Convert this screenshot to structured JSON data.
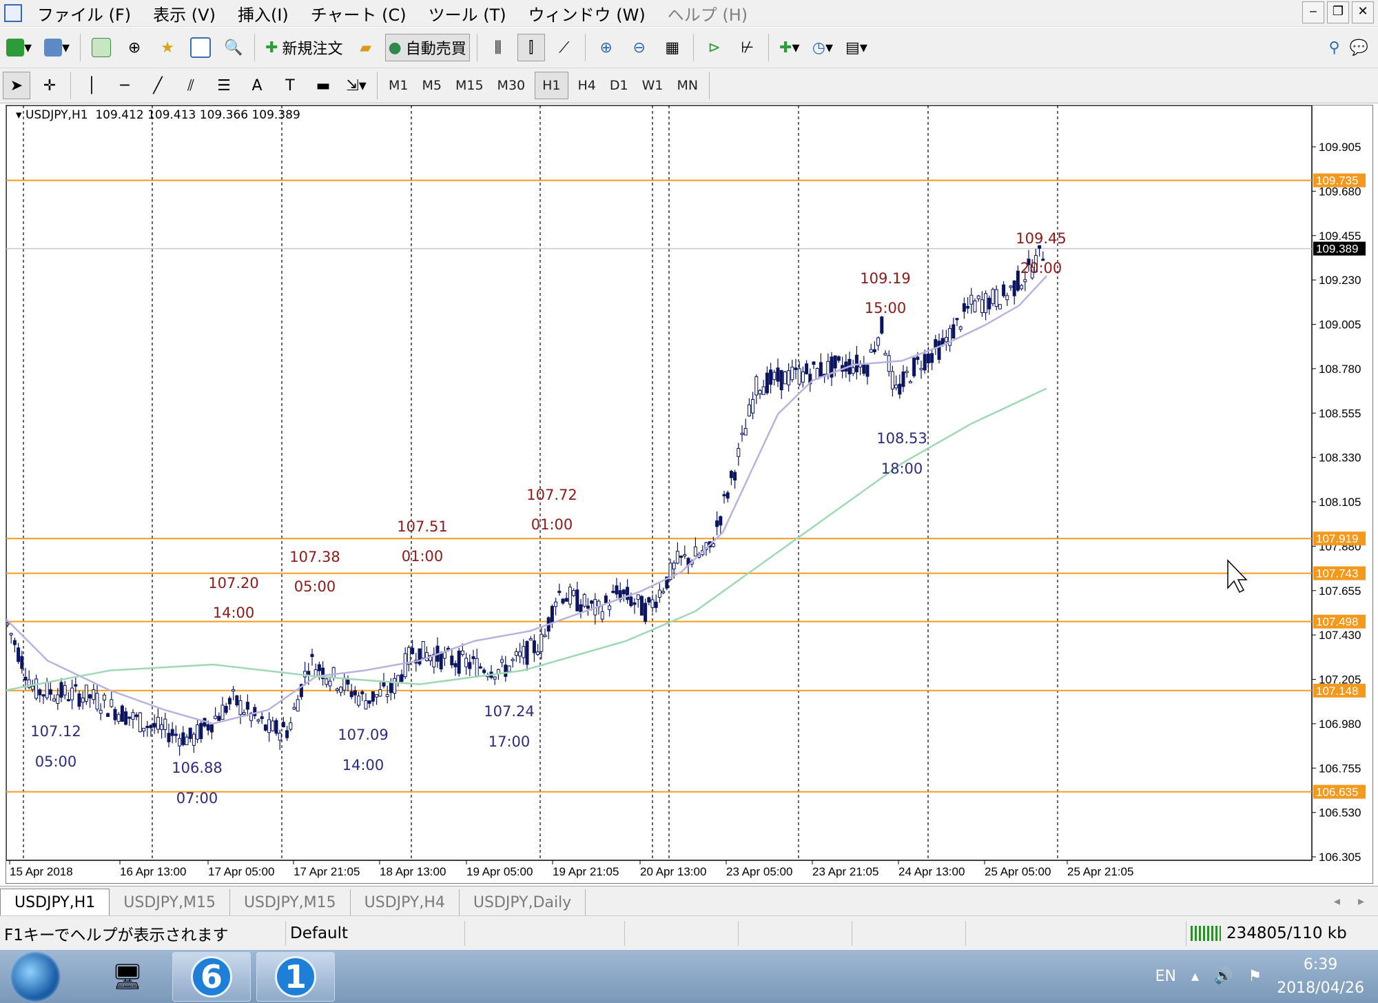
{
  "menu": {
    "items": [
      "ファイル (F)",
      "表示 (V)",
      "挿入(I)",
      "チャート (C)",
      "ツール (T)",
      "ウィンドウ (W)",
      "ヘルプ (H)"
    ]
  },
  "toolbar": {
    "new_order": "新規注文",
    "auto_trading": "自動売買",
    "timeframes": [
      "M1",
      "M5",
      "M15",
      "M30",
      "H1",
      "H4",
      "D1",
      "W1",
      "MN"
    ],
    "active_timeframe": "H1"
  },
  "chart": {
    "header": "USDJPY,H1  109.412 109.413 109.366 109.389",
    "current_price": "109.389",
    "price_axis_ticks": [
      "109.905",
      "109.680",
      "109.455",
      "109.230",
      "109.005",
      "108.780",
      "108.555",
      "108.330",
      "108.105",
      "107.880",
      "107.655",
      "107.430",
      "107.205",
      "106.980",
      "106.755",
      "106.530",
      "106.305"
    ],
    "time_axis_ticks": [
      "15 Apr 2018",
      "16 Apr 13:00",
      "17 Apr 05:00",
      "17 Apr 21:05",
      "18 Apr 13:00",
      "19 Apr 05:00",
      "19 Apr 21:05",
      "20 Apr 13:00",
      "23 Apr 05:00",
      "23 Apr 21:05",
      "24 Apr 13:00",
      "25 Apr 05:00",
      "25 Apr 21:05"
    ],
    "horizontal_levels": [
      "109.735",
      "107.919",
      "107.743",
      "107.498",
      "107.148",
      "106.635"
    ],
    "high_labels": [
      {
        "price": "107.20",
        "time": "14:00"
      },
      {
        "price": "107.38",
        "time": "05:00"
      },
      {
        "price": "107.51",
        "time": "01:00"
      },
      {
        "price": "107.72",
        "time": "01:00"
      },
      {
        "price": "109.19",
        "time": "15:00"
      },
      {
        "price": "109.45",
        "time": "20:00"
      }
    ],
    "low_labels": [
      {
        "price": "107.12",
        "time": "05:00"
      },
      {
        "price": "106.88",
        "time": "07:00"
      },
      {
        "price": "107.09",
        "time": "14:00"
      },
      {
        "price": "107.24",
        "time": "17:00"
      },
      {
        "price": "108.53",
        "time": "18:00"
      }
    ],
    "colors": {
      "level": "#f39a1e",
      "high_label": "#8b1a1a",
      "low_label": "#2c2c7a",
      "candle": "#0b1560",
      "ma_fast": "#b9b2e0",
      "ma_slow": "#9ed8b5"
    }
  },
  "tabs": [
    "USDJPY,H1",
    "USDJPY,M15",
    "USDJPY,M15",
    "USDJPY,H4",
    "USDJPY,Daily"
  ],
  "status": {
    "help": "F1キーでヘルプが表示されます",
    "profile": "Default",
    "traffic": "234805/110 kb"
  },
  "taskbar": {
    "app6": "6",
    "app1": "1",
    "lang": "EN",
    "time": "6:39",
    "date": "2018/04/26"
  }
}
